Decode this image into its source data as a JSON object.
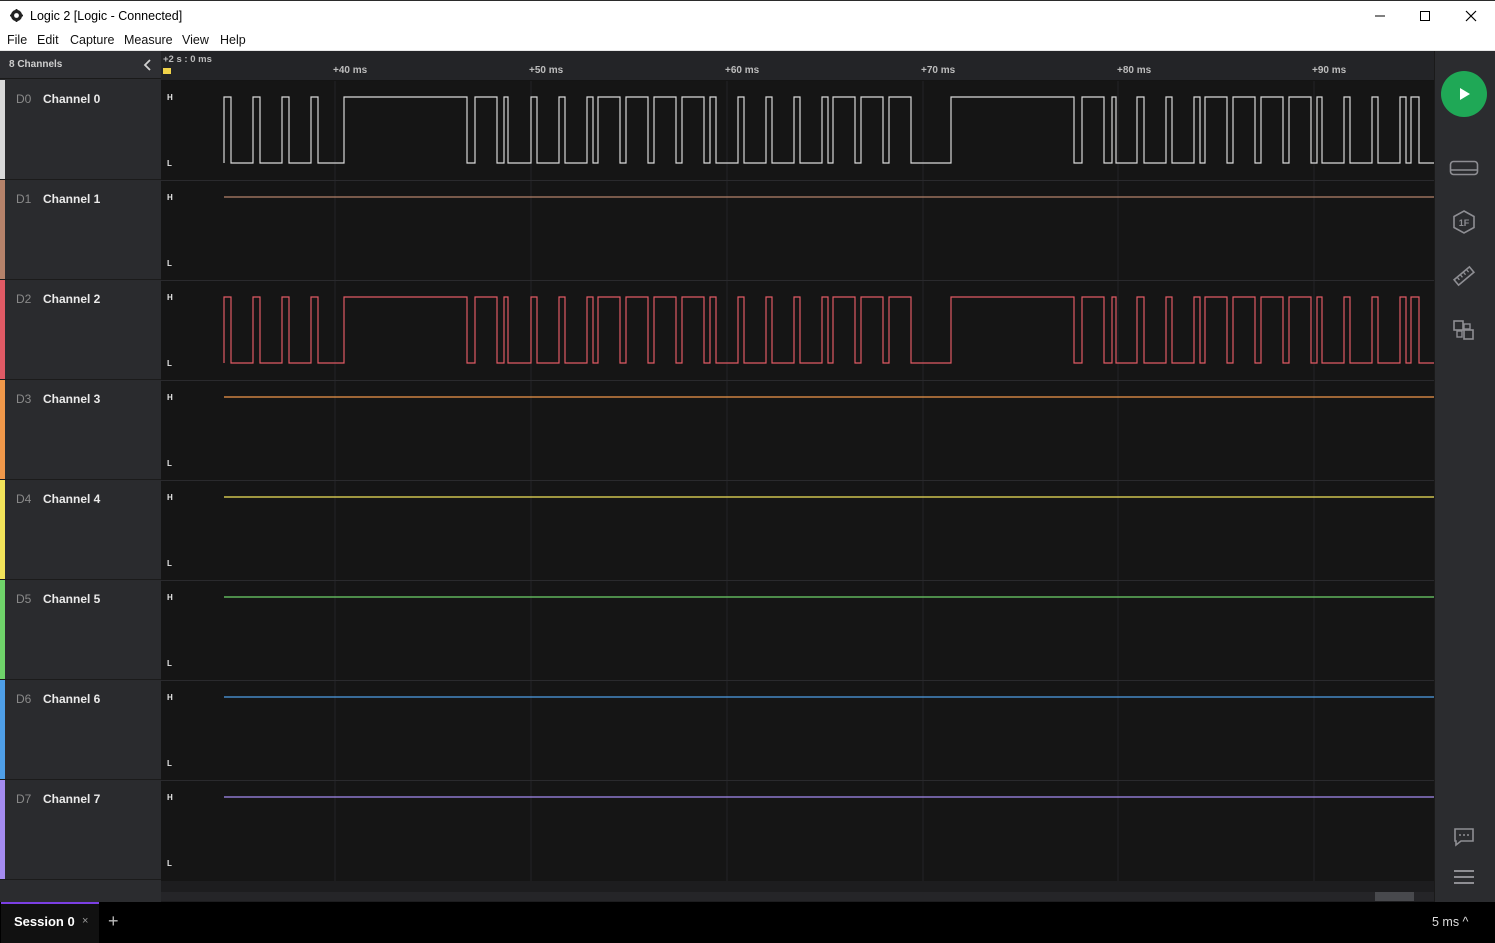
{
  "window": {
    "title": "Logic 2 [Logic - Connected]"
  },
  "menu": [
    "File",
    "Edit",
    "Capture",
    "Measure",
    "View",
    "Help"
  ],
  "panel": {
    "header": "8 Channels"
  },
  "channels": [
    {
      "id": "D0",
      "name": "Channel 0",
      "color": "#d9d9d9"
    },
    {
      "id": "D1",
      "name": "Channel 1",
      "color": "#b5826a"
    },
    {
      "id": "D2",
      "name": "Channel 2",
      "color": "#e05a65"
    },
    {
      "id": "D3",
      "name": "Channel 3",
      "color": "#f0984a"
    },
    {
      "id": "D4",
      "name": "Channel 4",
      "color": "#f2e35a"
    },
    {
      "id": "D5",
      "name": "Channel 5",
      "color": "#6fd36a"
    },
    {
      "id": "D6",
      "name": "Channel 6",
      "color": "#4f9fe8"
    },
    {
      "id": "D7",
      "name": "Channel 7",
      "color": "#a58cf0"
    }
  ],
  "levels": {
    "high": "H",
    "low": "L"
  },
  "timeline": {
    "origin": "+2 s : 0 ms",
    "ticks": [
      "+40 ms",
      "+50 ms",
      "+60 ms",
      "+70 ms",
      "+80 ms",
      "+90 ms"
    ]
  },
  "session": {
    "tab": "Session 0",
    "close": "×",
    "add": "+",
    "zoom": "5 ms ^"
  },
  "icons": {
    "app": "logic-app-icon",
    "minimize": "minimize-icon",
    "maximize": "maximize-icon",
    "close": "close-icon",
    "collapse": "chevron-left-icon",
    "play": "play-icon",
    "device": "device-icon",
    "analyzer": "analyzer-icon",
    "measure": "ruler-icon",
    "extensions": "extensions-icon",
    "chat": "chat-icon",
    "menu": "hamburger-icon"
  }
}
